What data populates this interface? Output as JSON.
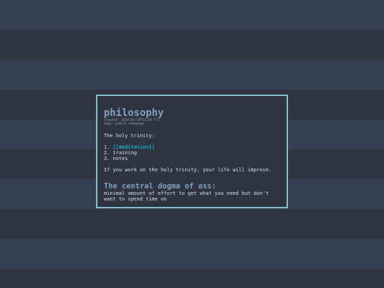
{
  "note": {
    "title": "philosophy",
    "created": "created: 2024-03-29T14:49 Fri",
    "tags": "tags: public homepage",
    "intro": "The holy trinity:",
    "list": [
      {
        "num": "1.",
        "text": "[[meditation]]",
        "is_link": true
      },
      {
        "num": "2.",
        "text": "training",
        "is_link": false
      },
      {
        "num": "3.",
        "text": "notes",
        "is_link": false
      }
    ],
    "statement": "If you work on the holy trinity, your life will improve.",
    "section_heading": "The central dogma of ass:",
    "section_text": "minimal amount of effort to get what you need but don't want to spend time on"
  },
  "colors": {
    "background": "#2e3440",
    "stripe": "#343f51",
    "border": "#88c0d0",
    "heading": "#81a1c1",
    "text": "#d8dee9",
    "link": "#00e5ff"
  }
}
